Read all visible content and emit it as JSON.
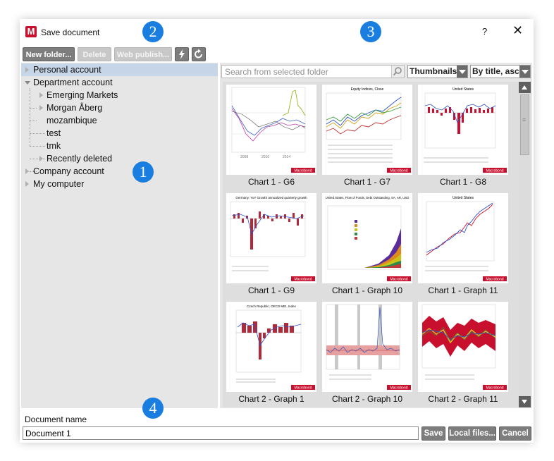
{
  "window": {
    "title": "Save document",
    "logo_letter": "M",
    "help": "?",
    "close": "✕"
  },
  "toolbar": {
    "new_folder": "New folder...",
    "delete": "Delete",
    "web_publish": "Web publish..."
  },
  "tree": {
    "items": [
      {
        "label": "Personal account",
        "selected": true
      },
      {
        "label": "Department account"
      },
      {
        "label": "Emerging Markets"
      },
      {
        "label": "Morgan Åberg"
      },
      {
        "label": "mozambique"
      },
      {
        "label": "test"
      },
      {
        "label": "tmk"
      },
      {
        "label": "Recently deleted"
      },
      {
        "label": "Company account"
      },
      {
        "label": "My computer"
      }
    ]
  },
  "search": {
    "placeholder": "Search from selected folder"
  },
  "view_select": {
    "value": "Thumbnails"
  },
  "sort_select": {
    "value": "By title, asc"
  },
  "thumbnails": [
    {
      "caption": "Chart 1 - G6",
      "chart_title": ""
    },
    {
      "caption": "Chart 1 - G7",
      "chart_title": "Equity Indices, Close"
    },
    {
      "caption": "Chart 1 - G8",
      "chart_title": "United States"
    },
    {
      "caption": "Chart 1 - G9",
      "chart_title": "Germany: YoY Growth annualized quarterly growth"
    },
    {
      "caption": "Chart 1 - Graph 10",
      "chart_title": "United States, Flow of Funds, Debt Outstanding, SA, AR, USD"
    },
    {
      "caption": "Chart 1 - Graph 11",
      "chart_title": "United States"
    },
    {
      "caption": "Chart 2 - Graph 1",
      "chart_title": "Czech Republic, OECD MEI, Index"
    },
    {
      "caption": "Chart 2 - Graph 10",
      "chart_title": ""
    },
    {
      "caption": "Chart 2 - Graph 11",
      "chart_title": ""
    }
  ],
  "source_label": "Macrobond",
  "doc": {
    "label": "Document name",
    "value": "Document 1"
  },
  "buttons": {
    "save": "Save",
    "local_files": "Local files...",
    "cancel": "Cancel"
  },
  "markers": [
    "1",
    "2",
    "3",
    "4"
  ],
  "colors": {
    "accent_blue": "#1a7ee0",
    "brand_red": "#c8102e",
    "button_gray": "#7d7d7d",
    "selection": "#c6d6e8"
  }
}
